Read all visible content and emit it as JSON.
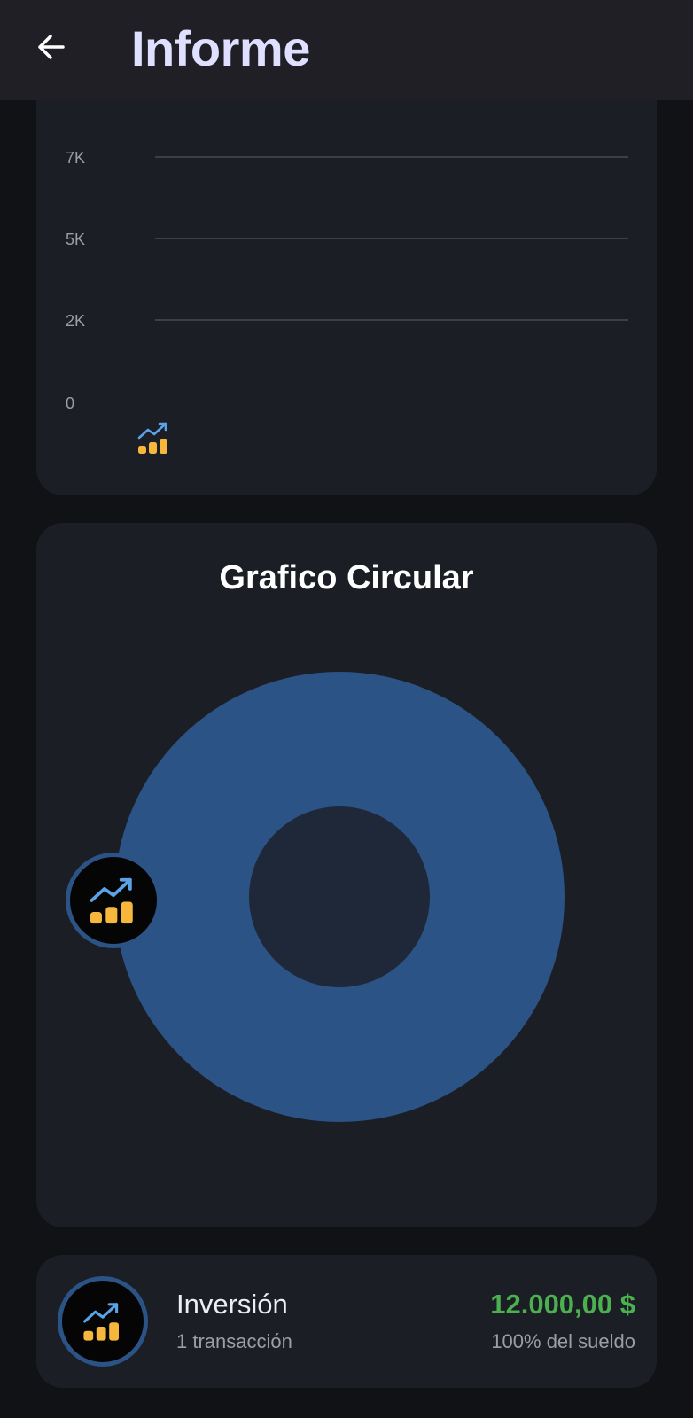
{
  "header": {
    "title": "Informe",
    "back_icon": "arrow-left-icon"
  },
  "colors": {
    "header_bg": "#1f1f25",
    "title": "#dfe0ff",
    "card_bg": "#1b1e25",
    "page_bg": "#111216",
    "slice": "#2b5385",
    "amount": "#4caf50"
  },
  "bar_chart": {
    "y_ticks": [
      "7K",
      "5K",
      "2K",
      "0"
    ],
    "category_icon": "investment-growth-icon"
  },
  "pie_chart": {
    "title": "Grafico Circular",
    "category_icon": "investment-growth-icon"
  },
  "chart_data": [
    {
      "type": "bar",
      "title": "",
      "xlabel": "",
      "ylabel": "",
      "y_ticks": [
        "7K",
        "5K",
        "2K",
        "0"
      ],
      "categories": [
        "Inversión"
      ],
      "values": [
        0
      ],
      "grid": true
    },
    {
      "type": "pie",
      "title": "Grafico Circular",
      "style": "donut",
      "categories": [
        "Inversión"
      ],
      "values": [
        100
      ],
      "colors": [
        "#2b5385"
      ]
    }
  ],
  "summary": {
    "category": "Inversión",
    "transactions": "1 transacción",
    "amount": "12.000,00 $",
    "percent": "100% del sueldo",
    "icon": "investment-growth-icon"
  }
}
